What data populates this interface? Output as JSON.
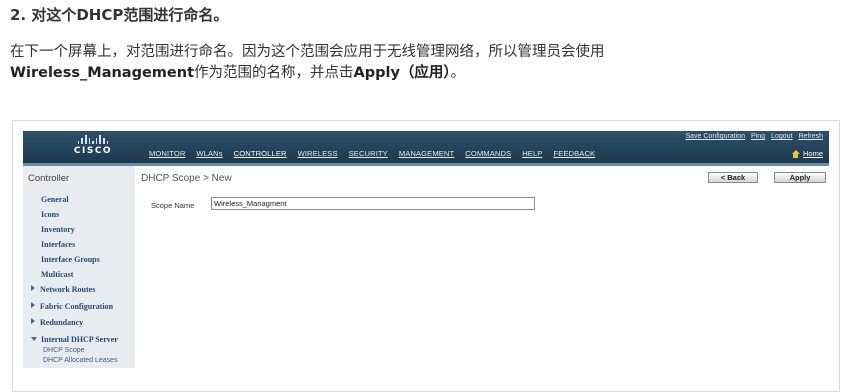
{
  "article": {
    "step_title": "2. 对这个DHCP范围进行命名。",
    "desc_part1": "在下一个屏幕上，对范围进行命名。因为这个范围会应用于无线管理网络，所以管理员会使用",
    "desc_bold1": "Wireless_Management",
    "desc_part2": "作为范围的名称，并点击",
    "desc_bold2": "Apply（应用）",
    "desc_part3": "。"
  },
  "wlc": {
    "brand": "CISCO",
    "top_nav": [
      "MONITOR",
      "WLANs",
      "CONTROLLER",
      "WIRELESS",
      "SECURITY",
      "MANAGEMENT",
      "COMMANDS",
      "HELP",
      "FEEDBACK"
    ],
    "active_nav": "CONTROLLER",
    "util_nav": [
      "Save Configuration",
      "Ping",
      "Logout",
      "Refresh"
    ],
    "home_label": "Home",
    "sidebar": {
      "title": "Controller",
      "items": [
        "General",
        "Icons",
        "Inventory",
        "Interfaces",
        "Interface Groups",
        "Multicast"
      ],
      "expandables": [
        "Network Routes",
        "Fabric Configuration",
        "Redundancy"
      ],
      "expanded": "Internal DHCP Server",
      "sub_items": [
        "DHCP Scope",
        "DHCP Allocated Leases"
      ]
    },
    "content": {
      "title": "DHCP Scope > New",
      "back_button": "< Back",
      "apply_button": "Apply",
      "scope_name_label": "Scope Name",
      "scope_name_value": "Wireless_Managment"
    }
  }
}
